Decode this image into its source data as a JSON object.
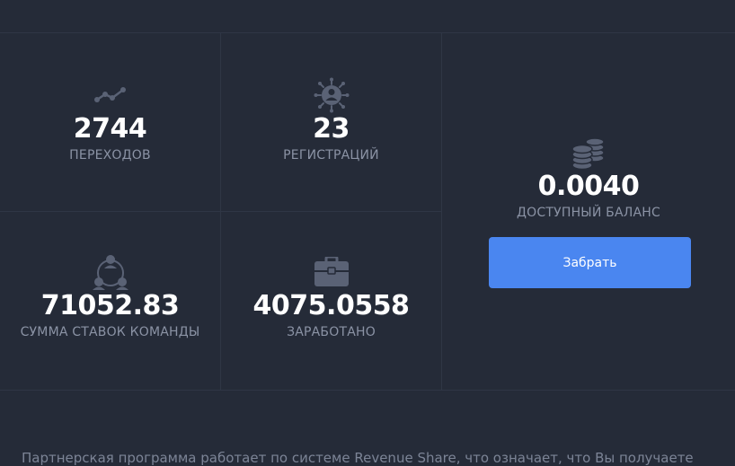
{
  "stats": {
    "clicks": {
      "value": "2744",
      "label": "ПЕРЕХОДОВ",
      "icon": "trend-line-icon"
    },
    "registrations": {
      "value": "23",
      "label": "РЕГИСТРАЦИЙ",
      "icon": "user-network-icon"
    },
    "team_bets": {
      "value": "71052.83",
      "label": "СУММА СТАВОК КОМАНДЫ",
      "icon": "team-icon"
    },
    "earned": {
      "value": "4075.0558",
      "label": "ЗАРАБОТАНО",
      "icon": "briefcase-icon"
    }
  },
  "balance": {
    "value": "0.0040",
    "label": "ДОСТУПНЫЙ БАЛАНС",
    "icon": "coins-icon",
    "button_label": "Забрать"
  },
  "footer": {
    "text": "Партнерская программа работает по системе Revenue Share, что означает, что Вы получаете"
  },
  "colors": {
    "background": "#252b38",
    "accent": "#4a86f0",
    "label": "#8b93a5",
    "icon": "#5a6275"
  }
}
